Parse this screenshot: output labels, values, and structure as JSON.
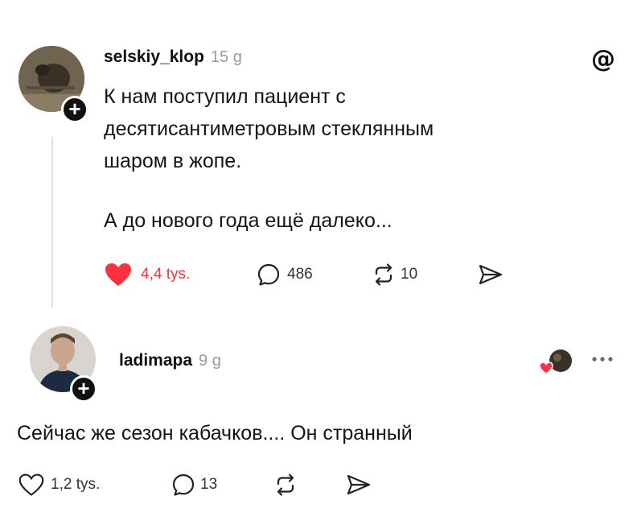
{
  "post1": {
    "username": "selskiy_klop",
    "time": "15 g",
    "text_line1": "К нам поступил пациент с",
    "text_line2": "десятисантиметровым стеклянным",
    "text_line3": "шаром в жопе.",
    "text_line4": "А до нового года ещё далеко...",
    "likes": "4,4 tys.",
    "comments": "486",
    "reposts": "10",
    "liked": true
  },
  "post2": {
    "username": "ladimapa",
    "time": "9 g",
    "text": "Сейчас же сезон кабачков.... Он странный",
    "likes": "1,2 tys.",
    "comments": "13"
  },
  "colors": {
    "like_red": "#ff3040",
    "muted": "#9a9a9a"
  },
  "icons": [
    "threads-logo-icon",
    "plus-icon",
    "heart-icon",
    "comment-icon",
    "repost-icon",
    "share-icon",
    "more-icon"
  ]
}
